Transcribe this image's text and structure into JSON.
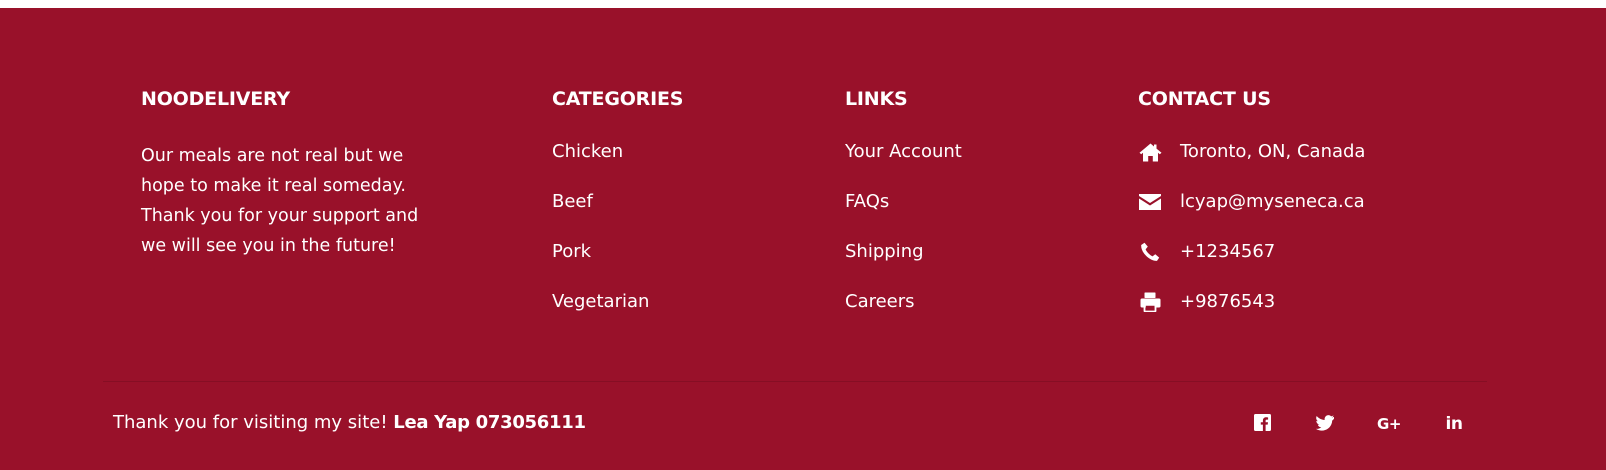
{
  "about": {
    "title": "NOODELIVERY",
    "text": "Our meals are not real but we hope to make it real someday. Thank you for your support and we will see you in the future!"
  },
  "categories": {
    "title": "CATEGORIES",
    "items": [
      "Chicken",
      "Beef",
      "Pork",
      "Vegetarian"
    ]
  },
  "links": {
    "title": "LINKS",
    "items": [
      "Your Account",
      "FAQs",
      "Shipping",
      "Careers"
    ]
  },
  "contact": {
    "title": "CONTACT US",
    "items": [
      {
        "icon": "home-icon",
        "text": "Toronto, ON, Canada"
      },
      {
        "icon": "envelope-icon",
        "text": "lcyap@myseneca.ca"
      },
      {
        "icon": "phone-icon",
        "text": "+1234567"
      },
      {
        "icon": "printer-icon",
        "text": "+9876543"
      }
    ]
  },
  "bottom": {
    "thanks": "Thank you for visiting my site!",
    "author": "Lea Yap 073056111"
  },
  "social": {
    "icons": [
      "facebook-icon",
      "twitter-icon",
      "google-plus-icon",
      "linkedin-icon"
    ],
    "gplus_glyph": "G+",
    "linkedin_glyph": "in"
  },
  "colors": {
    "footer_bg": "#99112a",
    "text": "#ffffff"
  }
}
